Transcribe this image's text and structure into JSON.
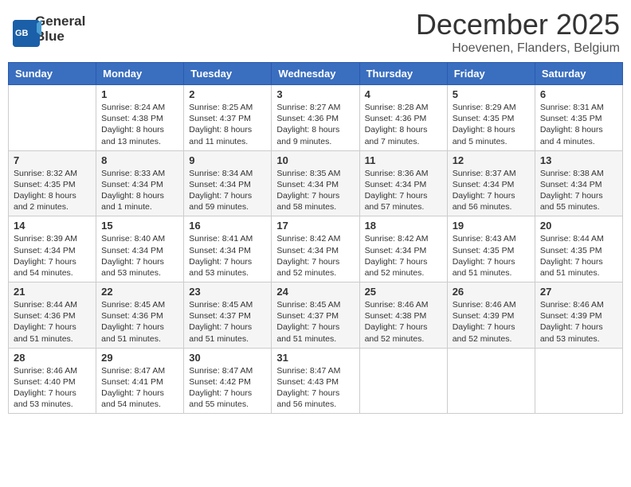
{
  "header": {
    "logo_line1": "General",
    "logo_line2": "Blue",
    "month": "December 2025",
    "location": "Hoevenen, Flanders, Belgium"
  },
  "days_of_week": [
    "Sunday",
    "Monday",
    "Tuesday",
    "Wednesday",
    "Thursday",
    "Friday",
    "Saturday"
  ],
  "weeks": [
    [
      {
        "day": "",
        "info": ""
      },
      {
        "day": "1",
        "info": "Sunrise: 8:24 AM\nSunset: 4:38 PM\nDaylight: 8 hours\nand 13 minutes."
      },
      {
        "day": "2",
        "info": "Sunrise: 8:25 AM\nSunset: 4:37 PM\nDaylight: 8 hours\nand 11 minutes."
      },
      {
        "day": "3",
        "info": "Sunrise: 8:27 AM\nSunset: 4:36 PM\nDaylight: 8 hours\nand 9 minutes."
      },
      {
        "day": "4",
        "info": "Sunrise: 8:28 AM\nSunset: 4:36 PM\nDaylight: 8 hours\nand 7 minutes."
      },
      {
        "day": "5",
        "info": "Sunrise: 8:29 AM\nSunset: 4:35 PM\nDaylight: 8 hours\nand 5 minutes."
      },
      {
        "day": "6",
        "info": "Sunrise: 8:31 AM\nSunset: 4:35 PM\nDaylight: 8 hours\nand 4 minutes."
      }
    ],
    [
      {
        "day": "7",
        "info": "Sunrise: 8:32 AM\nSunset: 4:35 PM\nDaylight: 8 hours\nand 2 minutes."
      },
      {
        "day": "8",
        "info": "Sunrise: 8:33 AM\nSunset: 4:34 PM\nDaylight: 8 hours\nand 1 minute."
      },
      {
        "day": "9",
        "info": "Sunrise: 8:34 AM\nSunset: 4:34 PM\nDaylight: 7 hours\nand 59 minutes."
      },
      {
        "day": "10",
        "info": "Sunrise: 8:35 AM\nSunset: 4:34 PM\nDaylight: 7 hours\nand 58 minutes."
      },
      {
        "day": "11",
        "info": "Sunrise: 8:36 AM\nSunset: 4:34 PM\nDaylight: 7 hours\nand 57 minutes."
      },
      {
        "day": "12",
        "info": "Sunrise: 8:37 AM\nSunset: 4:34 PM\nDaylight: 7 hours\nand 56 minutes."
      },
      {
        "day": "13",
        "info": "Sunrise: 8:38 AM\nSunset: 4:34 PM\nDaylight: 7 hours\nand 55 minutes."
      }
    ],
    [
      {
        "day": "14",
        "info": "Sunrise: 8:39 AM\nSunset: 4:34 PM\nDaylight: 7 hours\nand 54 minutes."
      },
      {
        "day": "15",
        "info": "Sunrise: 8:40 AM\nSunset: 4:34 PM\nDaylight: 7 hours\nand 53 minutes."
      },
      {
        "day": "16",
        "info": "Sunrise: 8:41 AM\nSunset: 4:34 PM\nDaylight: 7 hours\nand 53 minutes."
      },
      {
        "day": "17",
        "info": "Sunrise: 8:42 AM\nSunset: 4:34 PM\nDaylight: 7 hours\nand 52 minutes."
      },
      {
        "day": "18",
        "info": "Sunrise: 8:42 AM\nSunset: 4:34 PM\nDaylight: 7 hours\nand 52 minutes."
      },
      {
        "day": "19",
        "info": "Sunrise: 8:43 AM\nSunset: 4:35 PM\nDaylight: 7 hours\nand 51 minutes."
      },
      {
        "day": "20",
        "info": "Sunrise: 8:44 AM\nSunset: 4:35 PM\nDaylight: 7 hours\nand 51 minutes."
      }
    ],
    [
      {
        "day": "21",
        "info": "Sunrise: 8:44 AM\nSunset: 4:36 PM\nDaylight: 7 hours\nand 51 minutes."
      },
      {
        "day": "22",
        "info": "Sunrise: 8:45 AM\nSunset: 4:36 PM\nDaylight: 7 hours\nand 51 minutes."
      },
      {
        "day": "23",
        "info": "Sunrise: 8:45 AM\nSunset: 4:37 PM\nDaylight: 7 hours\nand 51 minutes."
      },
      {
        "day": "24",
        "info": "Sunrise: 8:45 AM\nSunset: 4:37 PM\nDaylight: 7 hours\nand 51 minutes."
      },
      {
        "day": "25",
        "info": "Sunrise: 8:46 AM\nSunset: 4:38 PM\nDaylight: 7 hours\nand 52 minutes."
      },
      {
        "day": "26",
        "info": "Sunrise: 8:46 AM\nSunset: 4:39 PM\nDaylight: 7 hours\nand 52 minutes."
      },
      {
        "day": "27",
        "info": "Sunrise: 8:46 AM\nSunset: 4:39 PM\nDaylight: 7 hours\nand 53 minutes."
      }
    ],
    [
      {
        "day": "28",
        "info": "Sunrise: 8:46 AM\nSunset: 4:40 PM\nDaylight: 7 hours\nand 53 minutes."
      },
      {
        "day": "29",
        "info": "Sunrise: 8:47 AM\nSunset: 4:41 PM\nDaylight: 7 hours\nand 54 minutes."
      },
      {
        "day": "30",
        "info": "Sunrise: 8:47 AM\nSunset: 4:42 PM\nDaylight: 7 hours\nand 55 minutes."
      },
      {
        "day": "31",
        "info": "Sunrise: 8:47 AM\nSunset: 4:43 PM\nDaylight: 7 hours\nand 56 minutes."
      },
      {
        "day": "",
        "info": ""
      },
      {
        "day": "",
        "info": ""
      },
      {
        "day": "",
        "info": ""
      }
    ]
  ]
}
